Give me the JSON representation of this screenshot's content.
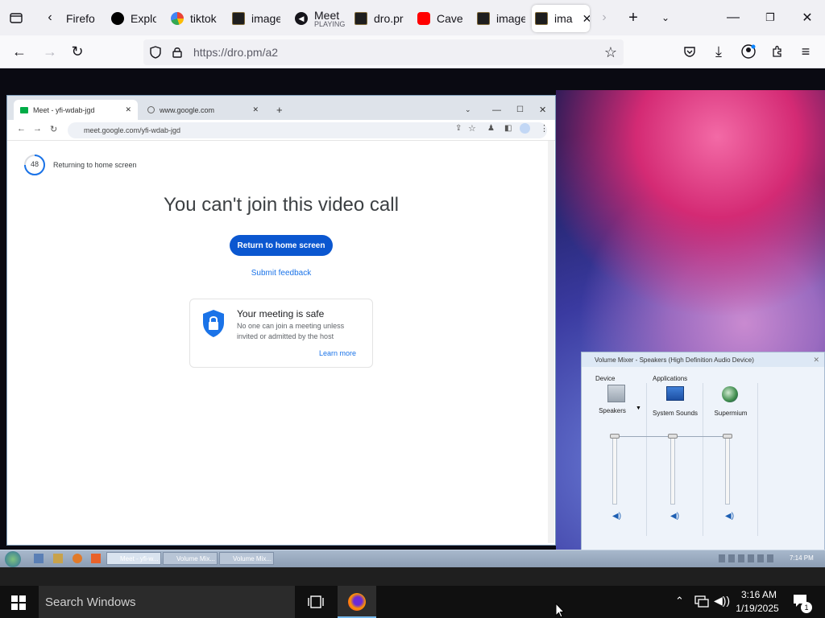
{
  "firefox": {
    "tabs": [
      {
        "label": "Firefo",
        "icon": "firefox-icon"
      },
      {
        "label": "Explor",
        "icon": "tiktok-icon"
      },
      {
        "label": "tiktok",
        "icon": "google-icon"
      },
      {
        "label": "image",
        "icon": "image-icon"
      },
      {
        "label": "Meet",
        "sub": "PLAYING",
        "icon": "speaker-icon"
      },
      {
        "label": "dro.pr",
        "icon": "image-icon"
      },
      {
        "label": "Cave",
        "icon": "youtube-icon"
      },
      {
        "label": "image",
        "icon": "image-icon"
      },
      {
        "label": "ima",
        "icon": "image-icon",
        "active": true
      }
    ],
    "url": "https://dro.pm/a2"
  },
  "chrome": {
    "tabs": [
      {
        "label": "Meet - yfi-wdab-jgd",
        "active": true
      },
      {
        "label": "www.google.com",
        "active": false
      }
    ],
    "url": "meet.google.com/yfi-wdab-jgd"
  },
  "meet": {
    "countdown": "48",
    "countdown_label": "Returning to home screen",
    "title": "You can't join this video call",
    "return_button": "Return to home screen",
    "feedback_link": "Submit feedback",
    "safe_title": "Your meeting is safe",
    "safe_body_line1": "No one can join a meeting unless",
    "safe_body_line2": "invited or admitted by the host",
    "learn_more": "Learn more"
  },
  "volume_mixer": {
    "title": "Volume Mixer - Speakers (High Definition Audio Device)",
    "device_header": "Device",
    "apps_header": "Applications",
    "channels": [
      {
        "label": "Speakers",
        "level": 1.0
      },
      {
        "label": "System Sounds",
        "level": 1.0
      },
      {
        "label": "Supermium",
        "level": 1.0
      }
    ]
  },
  "xp_taskbar": {
    "tasks": [
      "Meet - yfi-w...",
      "Volume Mix...",
      "Volume Mix..."
    ],
    "clock": "7:14 PM"
  },
  "windows_taskbar": {
    "search_placeholder": "Search Windows",
    "time": "3:16 AM",
    "date": "1/19/2025",
    "notification_count": "1"
  }
}
